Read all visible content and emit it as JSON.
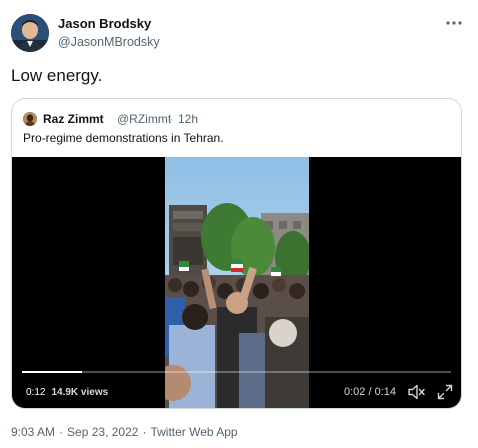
{
  "author": {
    "name": "Jason Brodsky",
    "handle": "@JasonMBrodsky"
  },
  "tweet": {
    "text": "Low energy."
  },
  "quoted_tweet": {
    "name": "Raz Zimmt",
    "handle": "@RZimmt",
    "separator": "·",
    "time": "12h",
    "text": "Pro-regime demonstrations in Tehran."
  },
  "video": {
    "elapsed": "0:12",
    "views": "14.9K views",
    "playback_time": "0:02 / 0:14",
    "progress": 0.14
  },
  "meta": {
    "time": "9:03 AM",
    "date": "Sep 23, 2022",
    "separator": "·",
    "source": "Twitter Web App"
  },
  "icons": {
    "more": "more-horizontal-icon",
    "mute": "speaker-muted-icon",
    "fullscreen": "fullscreen-icon"
  },
  "colors": {
    "secondary_text": "#536471",
    "border": "#cfd9de",
    "video_background": "#000000"
  }
}
